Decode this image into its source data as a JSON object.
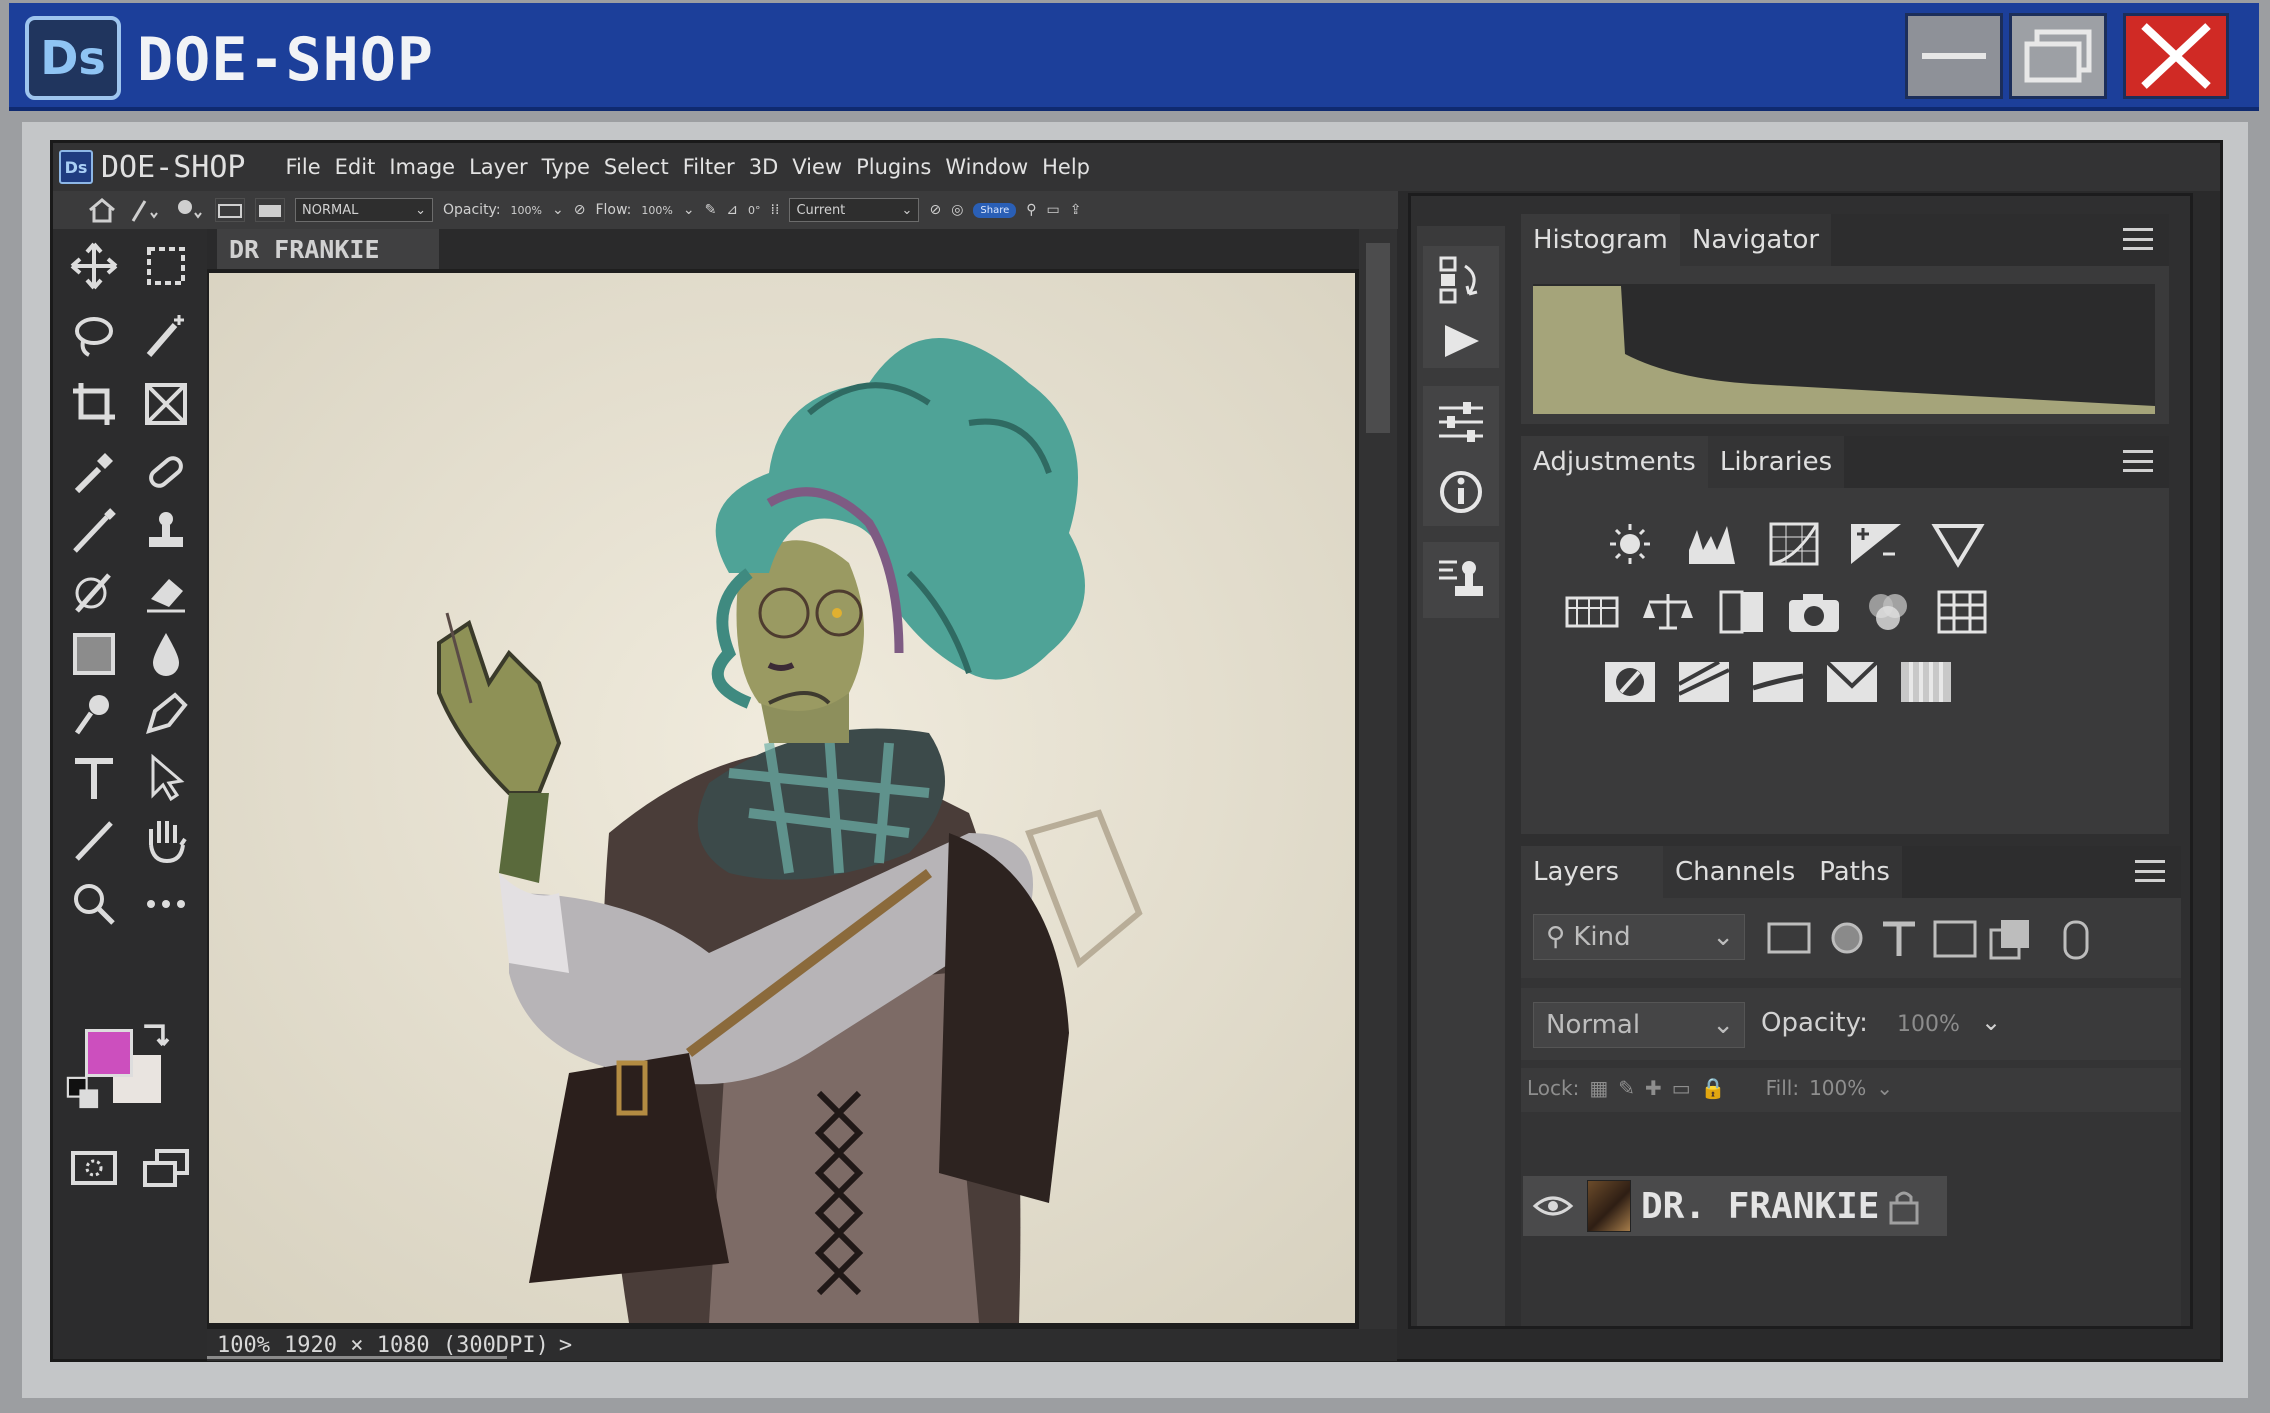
{
  "window": {
    "logo": "Ds",
    "title": "DOE-SHOP",
    "controls": [
      "minimize",
      "maximize",
      "close"
    ]
  },
  "app": {
    "logo": "Ds",
    "title": "DOE-SHOP",
    "menu": [
      "File",
      "Edit",
      "Image",
      "Layer",
      "Type",
      "Select",
      "Filter",
      "3D",
      "View",
      "Plugins",
      "Window",
      "Help"
    ]
  },
  "options": {
    "blend_mode": "NORMAL",
    "opacity_label": "Opacity:",
    "opacity_value": "100%",
    "flow_label": "Flow:",
    "flow_value": "100%",
    "angle_value": "0°",
    "sample": "Current",
    "share": "Share"
  },
  "document": {
    "tab": "DR FRANKIE"
  },
  "status": {
    "zoom": "100%",
    "dimensions": "1920 × 1080 (300DPI)",
    "arrow": ">"
  },
  "tools": [
    "move-tool",
    "marquee-tool",
    "lasso-tool",
    "magic-wand-tool",
    "crop-tool",
    "frame-tool",
    "eyedropper-tool",
    "healing-tool",
    "brush-tool",
    "stamp-tool",
    "history-brush-tool",
    "eraser-tool",
    "gradient-tool",
    "blur-tool",
    "dodge-tool",
    "pen-tool",
    "type-tool",
    "path-select-tool",
    "line-tool",
    "hand-tool",
    "zoom-tool",
    "more-tools"
  ],
  "colors": {
    "foreground": "#cc4fbe",
    "background": "#e9e4e0",
    "titlebar": "#1c3f9a",
    "close": "#d02a25"
  },
  "panels": {
    "top_tabs": [
      "Histogram",
      "Navigator"
    ],
    "mid_tabs": [
      "Adjustments",
      "Libraries"
    ],
    "adjustments": [
      "brightness-icon",
      "levels-icon",
      "curves-icon",
      "exposure-icon",
      "vibrance-icon",
      "hue-saturation-icon",
      "color-balance-icon",
      "black-white-icon",
      "photo-filter-icon",
      "channel-mixer-icon",
      "color-lookup-icon",
      "invert-icon",
      "posterize-icon",
      "threshold-icon",
      "gradient-map-icon",
      "selective-color-icon"
    ],
    "layer_tabs": [
      "Layers",
      "Channels",
      "Paths"
    ],
    "filter_kind": "Kind",
    "blend": "Normal",
    "opacity_label": "Opacity:",
    "opacity_value": "100%",
    "lock_label": "Lock:",
    "fill_label": "Fill:",
    "fill_value": "100%",
    "layer_name": "DR. FRANKIE"
  }
}
